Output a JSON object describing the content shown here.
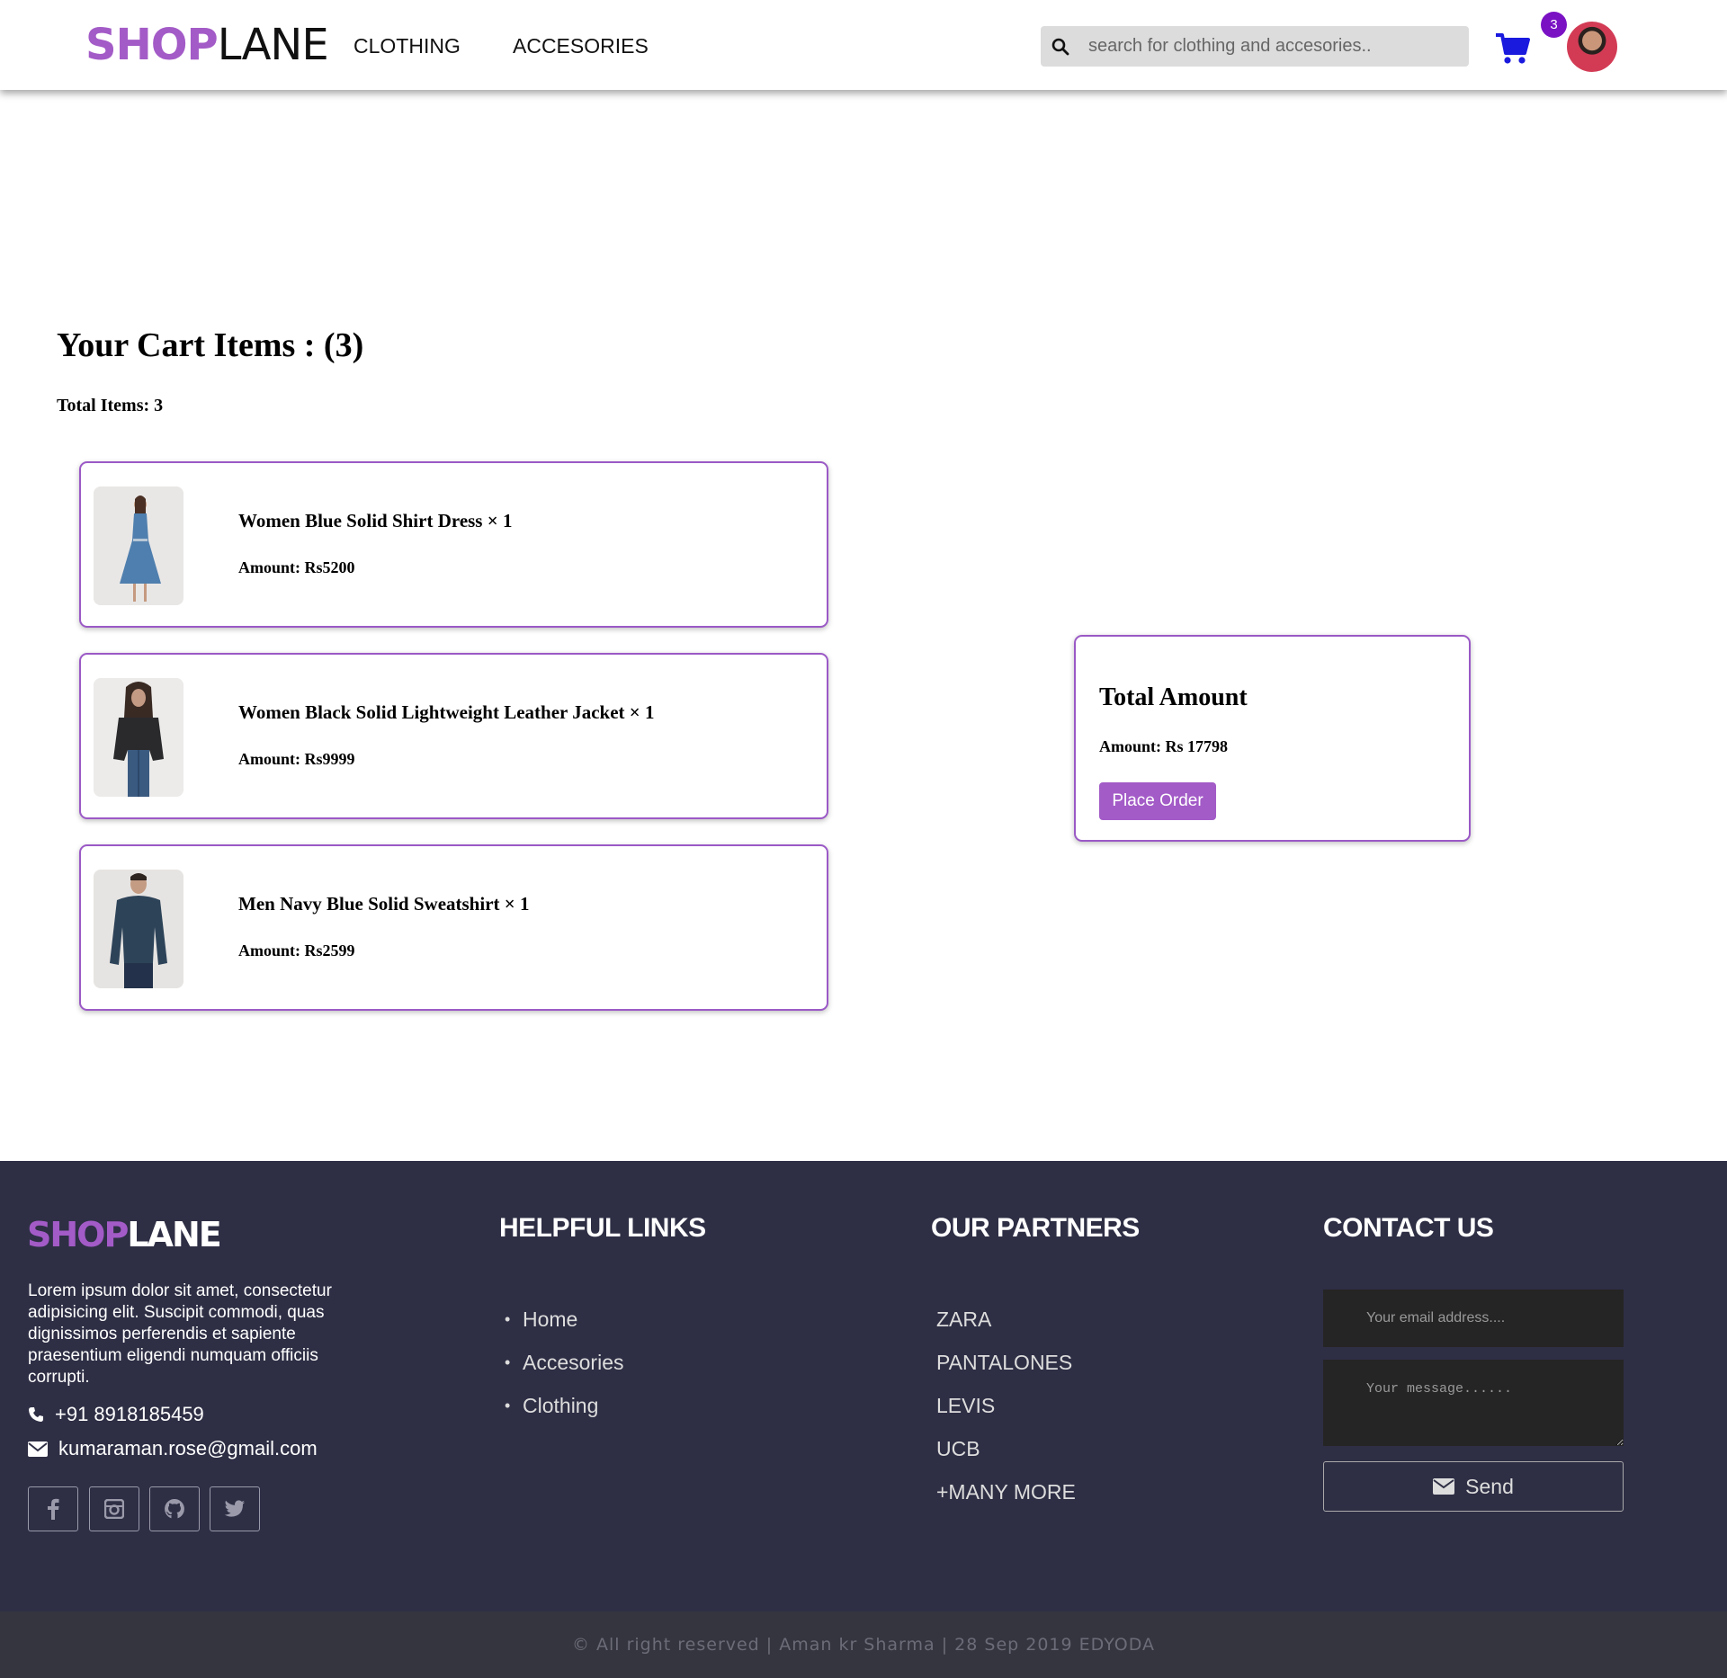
{
  "header": {
    "logo_shop": "SHOP",
    "logo_lane": "LANE",
    "nav": [
      "CLOTHING",
      "ACCESORIES"
    ],
    "search_placeholder": "search for clothing and accesories..",
    "cart_count": "3",
    "icons": {
      "search": "search-icon",
      "cart": "shopping-cart-icon",
      "avatar": "user-avatar"
    }
  },
  "cart": {
    "title": "Your Cart Items : (3)",
    "total_items": "Total Items: 3",
    "items": [
      {
        "name": "Women Blue Solid Shirt Dress × 1",
        "amount": "Amount: Rs5200"
      },
      {
        "name": "Women Black Solid Lightweight Leather Jacket × 1",
        "amount": "Amount: Rs9999"
      },
      {
        "name": "Men Navy Blue Solid Sweatshirt × 1",
        "amount": "Amount: Rs2599"
      }
    ]
  },
  "summary": {
    "title": "Total Amount",
    "amount": "Amount: Rs 17798",
    "button": "Place Order"
  },
  "footer": {
    "logo_shop": "SHOP",
    "logo_lane": "LANE",
    "description": "Lorem ipsum dolor sit amet, consectetur adipisicing elit. Suscipit commodi, quas dignissimos perferendis et sapiente praesentium eligendi numquam officiis corrupti.",
    "phone": "+91 8918185459",
    "email": "kumaraman.rose@gmail.com",
    "social": [
      "facebook-icon",
      "instagram-icon",
      "github-icon",
      "twitter-icon"
    ],
    "helpful_title": "HELPFUL LINKS",
    "helpful_links": [
      "Home",
      "Accesories",
      "Clothing"
    ],
    "partners_title": "OUR PARTNERS",
    "partners": [
      "ZARA",
      "PANTALONES",
      "LEVIS",
      "UCB",
      "+MANY MORE"
    ],
    "contact_title": "CONTACT US",
    "email_placeholder": "Your email address....",
    "message_placeholder": "Your message......",
    "send": "Send"
  },
  "copyright": "© All right reserved | Aman kr Sharma | 28 Sep 2019 EDYODA",
  "colors": {
    "brand": "#a35bc7",
    "badge": "#7a12c4",
    "cart_icon": "#1a1adf",
    "footer_bg": "#2e2f45",
    "copyright_bg": "#34353f"
  }
}
